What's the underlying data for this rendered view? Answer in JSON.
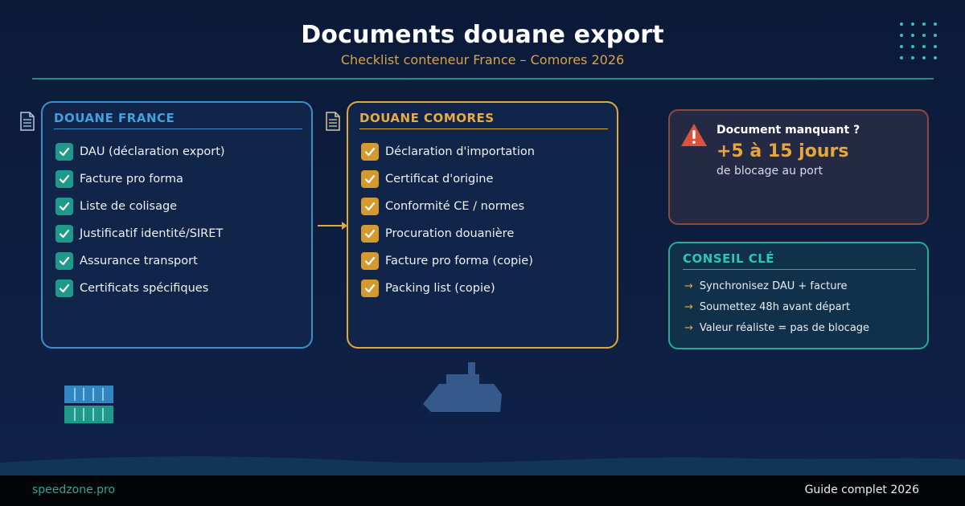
{
  "header": {
    "title": "Documents douane export",
    "subtitle": "Checklist conteneur France – Comores 2026"
  },
  "france": {
    "heading": "DOUANE FRANCE",
    "items": [
      "DAU (déclaration export)",
      "Facture pro forma",
      "Liste de colisage",
      "Justificatif identité/SIRET",
      "Assurance transport",
      "Certificats spécifiques"
    ]
  },
  "comores": {
    "heading": "DOUANE COMORES",
    "items": [
      "Déclaration d'importation",
      "Certificat d'origine",
      "Conformité CE / normes",
      "Procuration douanière",
      "Facture pro forma (copie)",
      "Packing list (copie)"
    ]
  },
  "alert": {
    "title": "Document manquant ?",
    "big": "+5 à 15 jours",
    "sub": "de blocage au port"
  },
  "tip": {
    "heading": "CONSEIL CLÉ",
    "items": [
      "Synchronisez DAU + facture",
      "Soumettez 48h avant départ",
      "Valeur réaliste = pas de blocage"
    ]
  },
  "footer": {
    "left": "speedzone.pro",
    "right": "Guide complet 2026"
  },
  "colors": {
    "background": "#0c1a38",
    "teal": "#2aa89a",
    "blue": "#3a8fc8",
    "gold": "#e1a93a",
    "alert_border": "#8a4a40"
  },
  "icons": [
    "document-icon",
    "check-icon",
    "arrow-right-icon",
    "warning-icon",
    "container-icon",
    "ship-icon"
  ]
}
